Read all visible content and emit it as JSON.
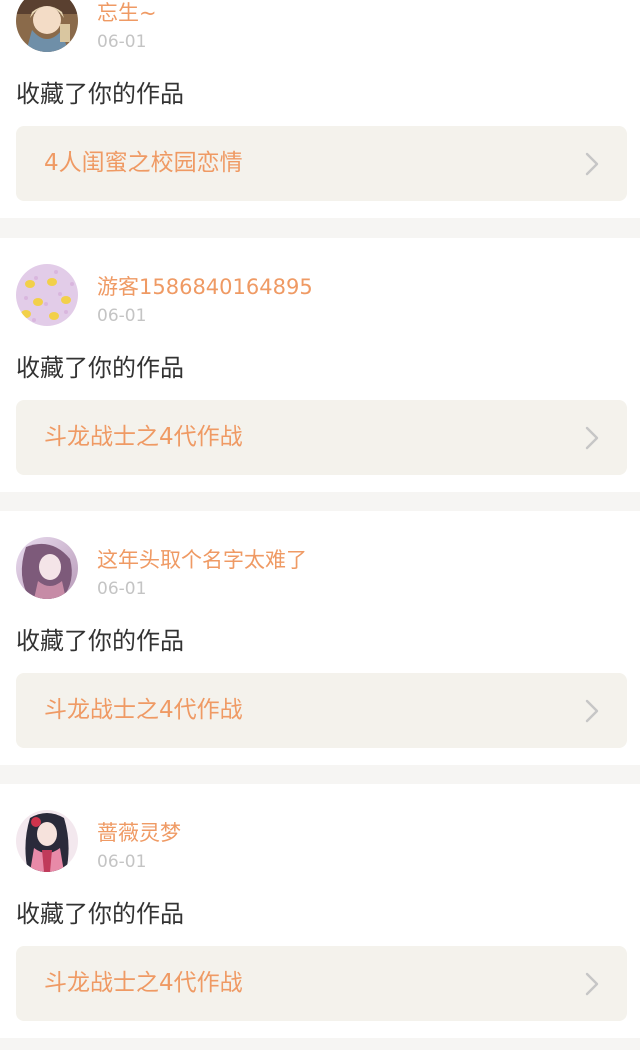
{
  "feed": {
    "items": [
      {
        "username": "忘生~",
        "date": "06-01",
        "action": "收藏了你的作品",
        "work_title": "4人闺蜜之校园恋情",
        "avatar_icon": "avatar-girl-icon"
      },
      {
        "username": "游客1586840164895",
        "date": "06-01",
        "action": "收藏了你的作品",
        "work_title": "斗龙战士之4代作战",
        "avatar_icon": "avatar-duck-pattern-icon"
      },
      {
        "username": "这年头取个名字太难了",
        "date": "06-01",
        "action": "收藏了你的作品",
        "work_title": "斗龙战士之4代作战",
        "avatar_icon": "avatar-anime-girl-icon"
      },
      {
        "username": "蔷薇灵梦",
        "date": "06-01",
        "action": "收藏了你的作品",
        "work_title": "斗龙战士之4代作战",
        "avatar_icon": "avatar-kimono-girl-icon"
      }
    ]
  },
  "colors": {
    "accent": "#ef9a64",
    "date": "#c4c4c4",
    "text": "#333333",
    "work_bg": "#f4f2ec",
    "page_bg": "#f6f5f3"
  }
}
